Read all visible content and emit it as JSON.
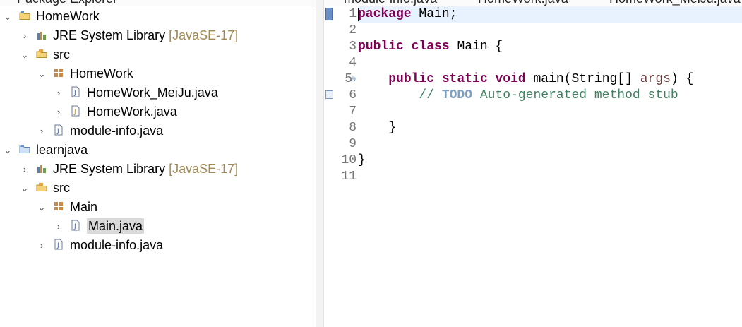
{
  "explorer": {
    "view_title": "Package Explorer",
    "items": [
      {
        "label": "HomeWork",
        "twisty": "v",
        "icon": "project-folder-icon"
      },
      {
        "label": "JRE System Library",
        "decoration": "[JavaSE-17]",
        "twisty": ">",
        "icon": "library-icon"
      },
      {
        "label": "src",
        "twisty": "v",
        "icon": "source-folder-icon"
      },
      {
        "label": "HomeWork",
        "twisty": "v",
        "icon": "package-icon"
      },
      {
        "label": "HomeWork_MeiJu.java",
        "twisty": ">",
        "icon": "java-file-icon"
      },
      {
        "label": "HomeWork.java",
        "twisty": ">",
        "icon": "java-file-icon"
      },
      {
        "label": "module-info.java",
        "twisty": ">",
        "icon": "java-file-icon"
      },
      {
        "label": "learnjava",
        "twisty": "v",
        "icon": "project-folder-icon"
      },
      {
        "label": "JRE System Library",
        "decoration": "[JavaSE-17]",
        "twisty": ">",
        "icon": "library-icon"
      },
      {
        "label": "src",
        "twisty": "v",
        "icon": "source-folder-icon"
      },
      {
        "label": "Main",
        "twisty": "v",
        "icon": "package-icon"
      },
      {
        "label": "Main.java",
        "twisty": ">",
        "icon": "java-file-icon",
        "selected": true
      },
      {
        "label": "module-info.java",
        "twisty": ">",
        "icon": "java-file-icon"
      }
    ]
  },
  "editor": {
    "tabs": [
      "module-info.java",
      "HomeWork.java",
      "HomeWork_MeiJu.java"
    ],
    "line_numbers": [
      "1",
      "2",
      "3",
      "4",
      "5",
      "6",
      "7",
      "8",
      "9",
      "10",
      "11"
    ],
    "code": {
      "l1_kw": "package",
      "l1_rest": " Main;",
      "l3_kw1": "public",
      "l3_kw2": "class",
      "l3_rest": " Main {",
      "l5_indent": "    ",
      "l5_kw1": "public",
      "l5_kw2": "static",
      "l5_kw3": "void",
      "l5_mid": " main(String[] ",
      "l5_param": "args",
      "l5_end": ") {",
      "l6_indent": "        ",
      "l6_slashes": "// ",
      "l6_todo": "TODO",
      "l6_rest": " Auto-generated method stub",
      "l8": "    }",
      "l10": "}"
    },
    "fold_glyph": "⊖",
    "colors": {
      "keyword": "#7f0055",
      "comment": "#3f7f5f",
      "todo": "#7f9fbf",
      "line_number": "#787878",
      "current_line": "#e8f2fe"
    }
  }
}
